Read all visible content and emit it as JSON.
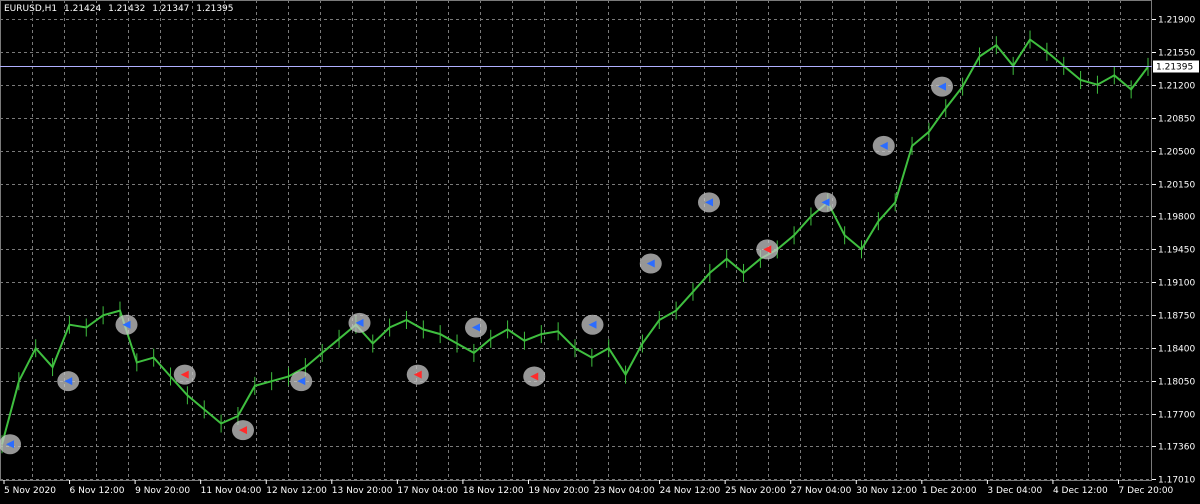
{
  "header": {
    "symbol": "EURUSD,H1",
    "open": "1.21424",
    "high": "1.21432",
    "low": "1.21347",
    "close": "1.21395"
  },
  "colors": {
    "background": "#000000",
    "grid": "#7a7a7a",
    "price_series": "#3fbf3f",
    "axis_text": "#ffffff",
    "price_line": "#b0b0ff",
    "buy_arrow": "#2b6cff",
    "sell_arrow": "#ff2b2b",
    "marker_halo": "#c8c8c8",
    "dashed_blue": "#3a3aff",
    "dashed_red": "#ff3030"
  },
  "chart_data": {
    "type": "line",
    "title": "EURUSD,H1",
    "ylim": [
      1.17,
      1.221
    ],
    "y_ticks": [
      "1.21900",
      "1.21550",
      "1.21200",
      "1.20850",
      "1.20500",
      "1.20150",
      "1.19800",
      "1.19450",
      "1.19100",
      "1.18750",
      "1.18400",
      "1.18050",
      "1.17700",
      "1.17360",
      "1.17010"
    ],
    "current_price": "1.21395",
    "x_ticks": [
      "5 Nov 2020",
      "6 Nov 12:00",
      "9 Nov 20:00",
      "11 Nov 04:00",
      "12 Nov 12:00",
      "13 Nov 20:00",
      "17 Nov 04:00",
      "18 Nov 12:00",
      "19 Nov 20:00",
      "23 Nov 04:00",
      "24 Nov 12:00",
      "25 Nov 20:00",
      "27 Nov 04:00",
      "30 Nov 12:00",
      "1 Dec 20:00",
      "3 Dec 04:00",
      "4 Dec 12:00",
      "7 Dec 20:00"
    ],
    "series": [
      {
        "values": [
          1.1738,
          1.1805,
          1.184,
          1.182,
          1.1865,
          1.1862,
          1.1875,
          1.188,
          1.1825,
          1.183,
          1.181,
          1.179,
          1.1775,
          1.176,
          1.1768,
          1.18,
          1.1805,
          1.181,
          1.182,
          1.1835,
          1.185,
          1.1865,
          1.1845,
          1.1862,
          1.187,
          1.186,
          1.1855,
          1.1845,
          1.1835,
          1.185,
          1.186,
          1.1848,
          1.1855,
          1.1858,
          1.184,
          1.183,
          1.184,
          1.1812,
          1.1845,
          1.187,
          1.188,
          1.19,
          1.192,
          1.1935,
          1.192,
          1.1935,
          1.1945,
          1.196,
          1.198,
          1.1995,
          1.196,
          1.1945,
          1.1975,
          1.1995,
          1.2055,
          1.207,
          1.2095,
          1.2118,
          1.215,
          1.2162,
          1.214,
          1.2168,
          1.2155,
          1.214,
          1.2125,
          1.212,
          1.213,
          1.2115,
          1.2139
        ]
      }
    ],
    "signals": [
      {
        "type": "buy",
        "value": 1.1738
      },
      {
        "type": "buy",
        "value": 1.1805
      },
      {
        "type": "buy",
        "value": 1.1865
      },
      {
        "type": "sell",
        "value": 1.1812
      },
      {
        "type": "sell",
        "value": 1.1753
      },
      {
        "type": "buy",
        "value": 1.1805
      },
      {
        "type": "buy",
        "value": 1.1867
      },
      {
        "type": "sell",
        "value": 1.1812
      },
      {
        "type": "buy",
        "value": 1.1862
      },
      {
        "type": "sell",
        "value": 1.181
      },
      {
        "type": "buy",
        "value": 1.1865
      },
      {
        "type": "buy",
        "value": 1.193
      },
      {
        "type": "buy",
        "value": 1.1995
      },
      {
        "type": "sell",
        "value": 1.1945
      },
      {
        "type": "buy",
        "value": 1.1995
      },
      {
        "type": "buy",
        "value": 1.2055
      },
      {
        "type": "buy",
        "value": 1.2118
      }
    ],
    "grid": true
  }
}
